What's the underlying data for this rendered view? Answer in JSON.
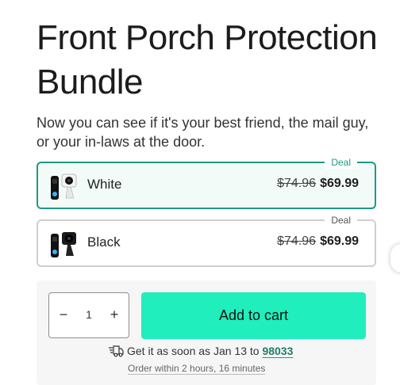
{
  "product": {
    "title": "Front Porch Protection Bundle",
    "subtitle": "Now you can see if it's your best friend, the mail guy, or your in-laws at the door."
  },
  "variants": [
    {
      "name": "White",
      "badge": "Deal",
      "old_price": "$74.96",
      "price": "$69.99",
      "selected": true
    },
    {
      "name": "Black",
      "badge": "Deal",
      "old_price": "$74.96",
      "price": "$69.99",
      "selected": false
    }
  ],
  "purchase": {
    "quantity": "1",
    "minus_label": "−",
    "plus_label": "+",
    "add_to_cart_label": "Add to cart"
  },
  "shipping": {
    "prefix": "Get it as soon as Jan 13 to",
    "zip": "98033",
    "order_within": "Order within 2 hours, 16 minutes"
  },
  "colors": {
    "accent": "#1d9a84",
    "cart_button": "#20eebd"
  }
}
